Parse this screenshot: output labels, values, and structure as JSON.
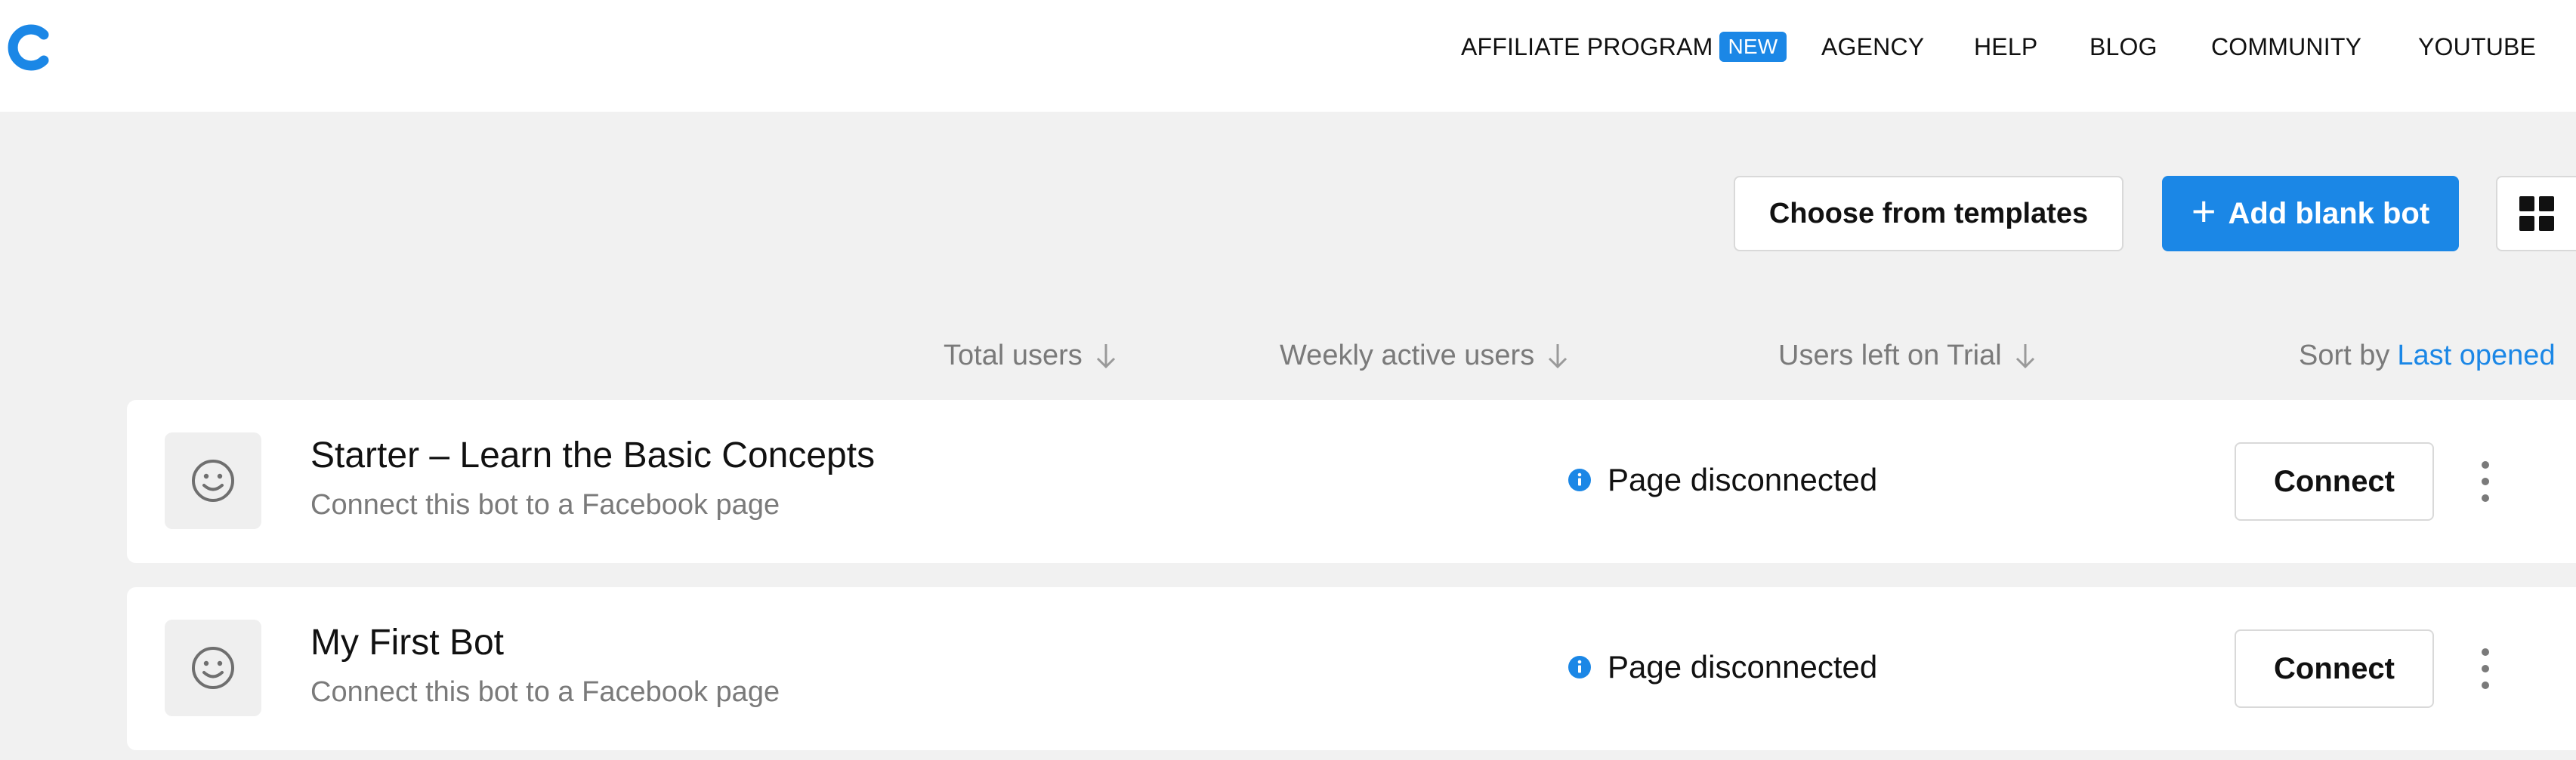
{
  "nav": {
    "affiliate": "AFFILIATE PROGRAM",
    "affiliate_badge": "NEW",
    "agency": "AGENCY",
    "help": "HELP",
    "blog": "BLOG",
    "community": "COMMUNITY",
    "youtube": "YOUTUBE"
  },
  "toolbar": {
    "templates_label": "Choose from templates",
    "add_label": "Add blank bot",
    "add_icon": "+"
  },
  "columns": {
    "total_users": "Total users",
    "weekly_active": "Weekly active users",
    "trial_users": "Users left on Trial",
    "sort_by": "Sort by",
    "sort_value": "Last opened"
  },
  "bots": [
    {
      "name": "Starter – Learn the Basic Concepts",
      "subtitle": "Connect this bot to a Facebook page",
      "status": "Page disconnected",
      "action": "Connect"
    },
    {
      "name": "My First Bot",
      "subtitle": "Connect this bot to a Facebook page",
      "status": "Page disconnected",
      "action": "Connect"
    }
  ],
  "icons": {
    "logo": "chatfuel-logo",
    "grid_view": "grid-view-icon",
    "avatar": "smiley-icon",
    "status": "info-icon",
    "menu": "more-vertical-icon",
    "sort": "arrow-down-icon"
  },
  "colors": {
    "accent": "#1b87e6",
    "background": "#f1f1f1",
    "muted_text": "#7a7a7a"
  }
}
